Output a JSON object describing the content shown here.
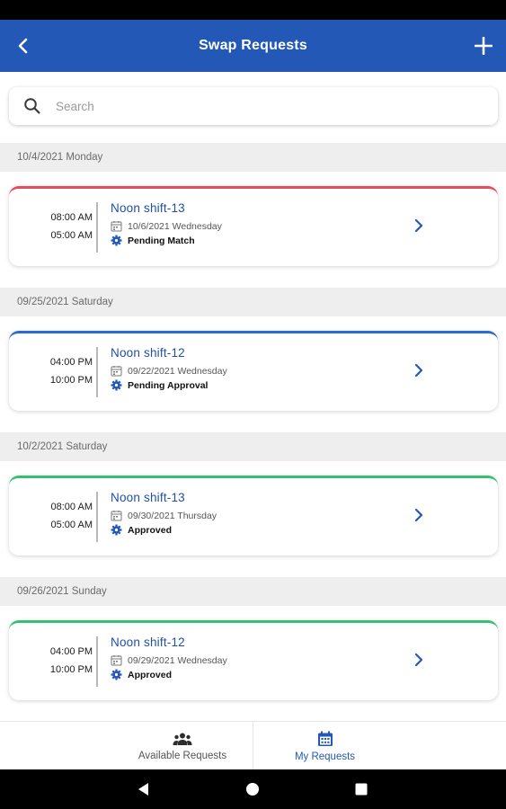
{
  "header": {
    "title": "Swap Requests"
  },
  "search": {
    "placeholder": "Search"
  },
  "sections": [
    {
      "date_label": "10/4/2021 Monday",
      "card": {
        "accent": "#e84c5c",
        "start_time": "08:00 AM",
        "end_time": "05:00 AM",
        "shift_name": "Noon shift-13",
        "date": "10/6/2021 Wednesday",
        "status": "Pending Match"
      }
    },
    {
      "date_label": "09/25/2021 Saturday",
      "card": {
        "accent": "#2a6ad6",
        "start_time": "04:00 PM",
        "end_time": "10:00 PM",
        "shift_name": "Noon shift-12",
        "date": "09/22/2021 Wednesday",
        "status": "Pending Approval"
      }
    },
    {
      "date_label": "10/2/2021 Saturday",
      "card": {
        "accent": "#37c073",
        "start_time": "08:00 AM",
        "end_time": "05:00 AM",
        "shift_name": "Noon shift-13",
        "date": "09/30/2021 Thursday",
        "status": "Approved"
      }
    },
    {
      "date_label": "09/26/2021 Sunday",
      "card": {
        "accent": "#37c073",
        "start_time": "04:00 PM",
        "end_time": "10:00 PM",
        "shift_name": "Noon shift-12",
        "date": "09/29/2021 Wednesday",
        "status": "Approved"
      }
    }
  ],
  "bottom_nav": {
    "available_label": "Available Requests",
    "mine_label": "My Requests",
    "active": "My Requests"
  },
  "colors": {
    "brand": "#2358b6",
    "pending_match": "#e84c5c",
    "pending_approval": "#2a6ad6",
    "approved": "#37c073"
  },
  "icons": {
    "back": "chevron-left-icon",
    "add": "plus-icon",
    "search": "search-icon",
    "calendar": "calendar-icon",
    "status": "gear-icon",
    "open": "chevron-right-icon",
    "available": "people-icon",
    "mine": "calendar-icon"
  }
}
